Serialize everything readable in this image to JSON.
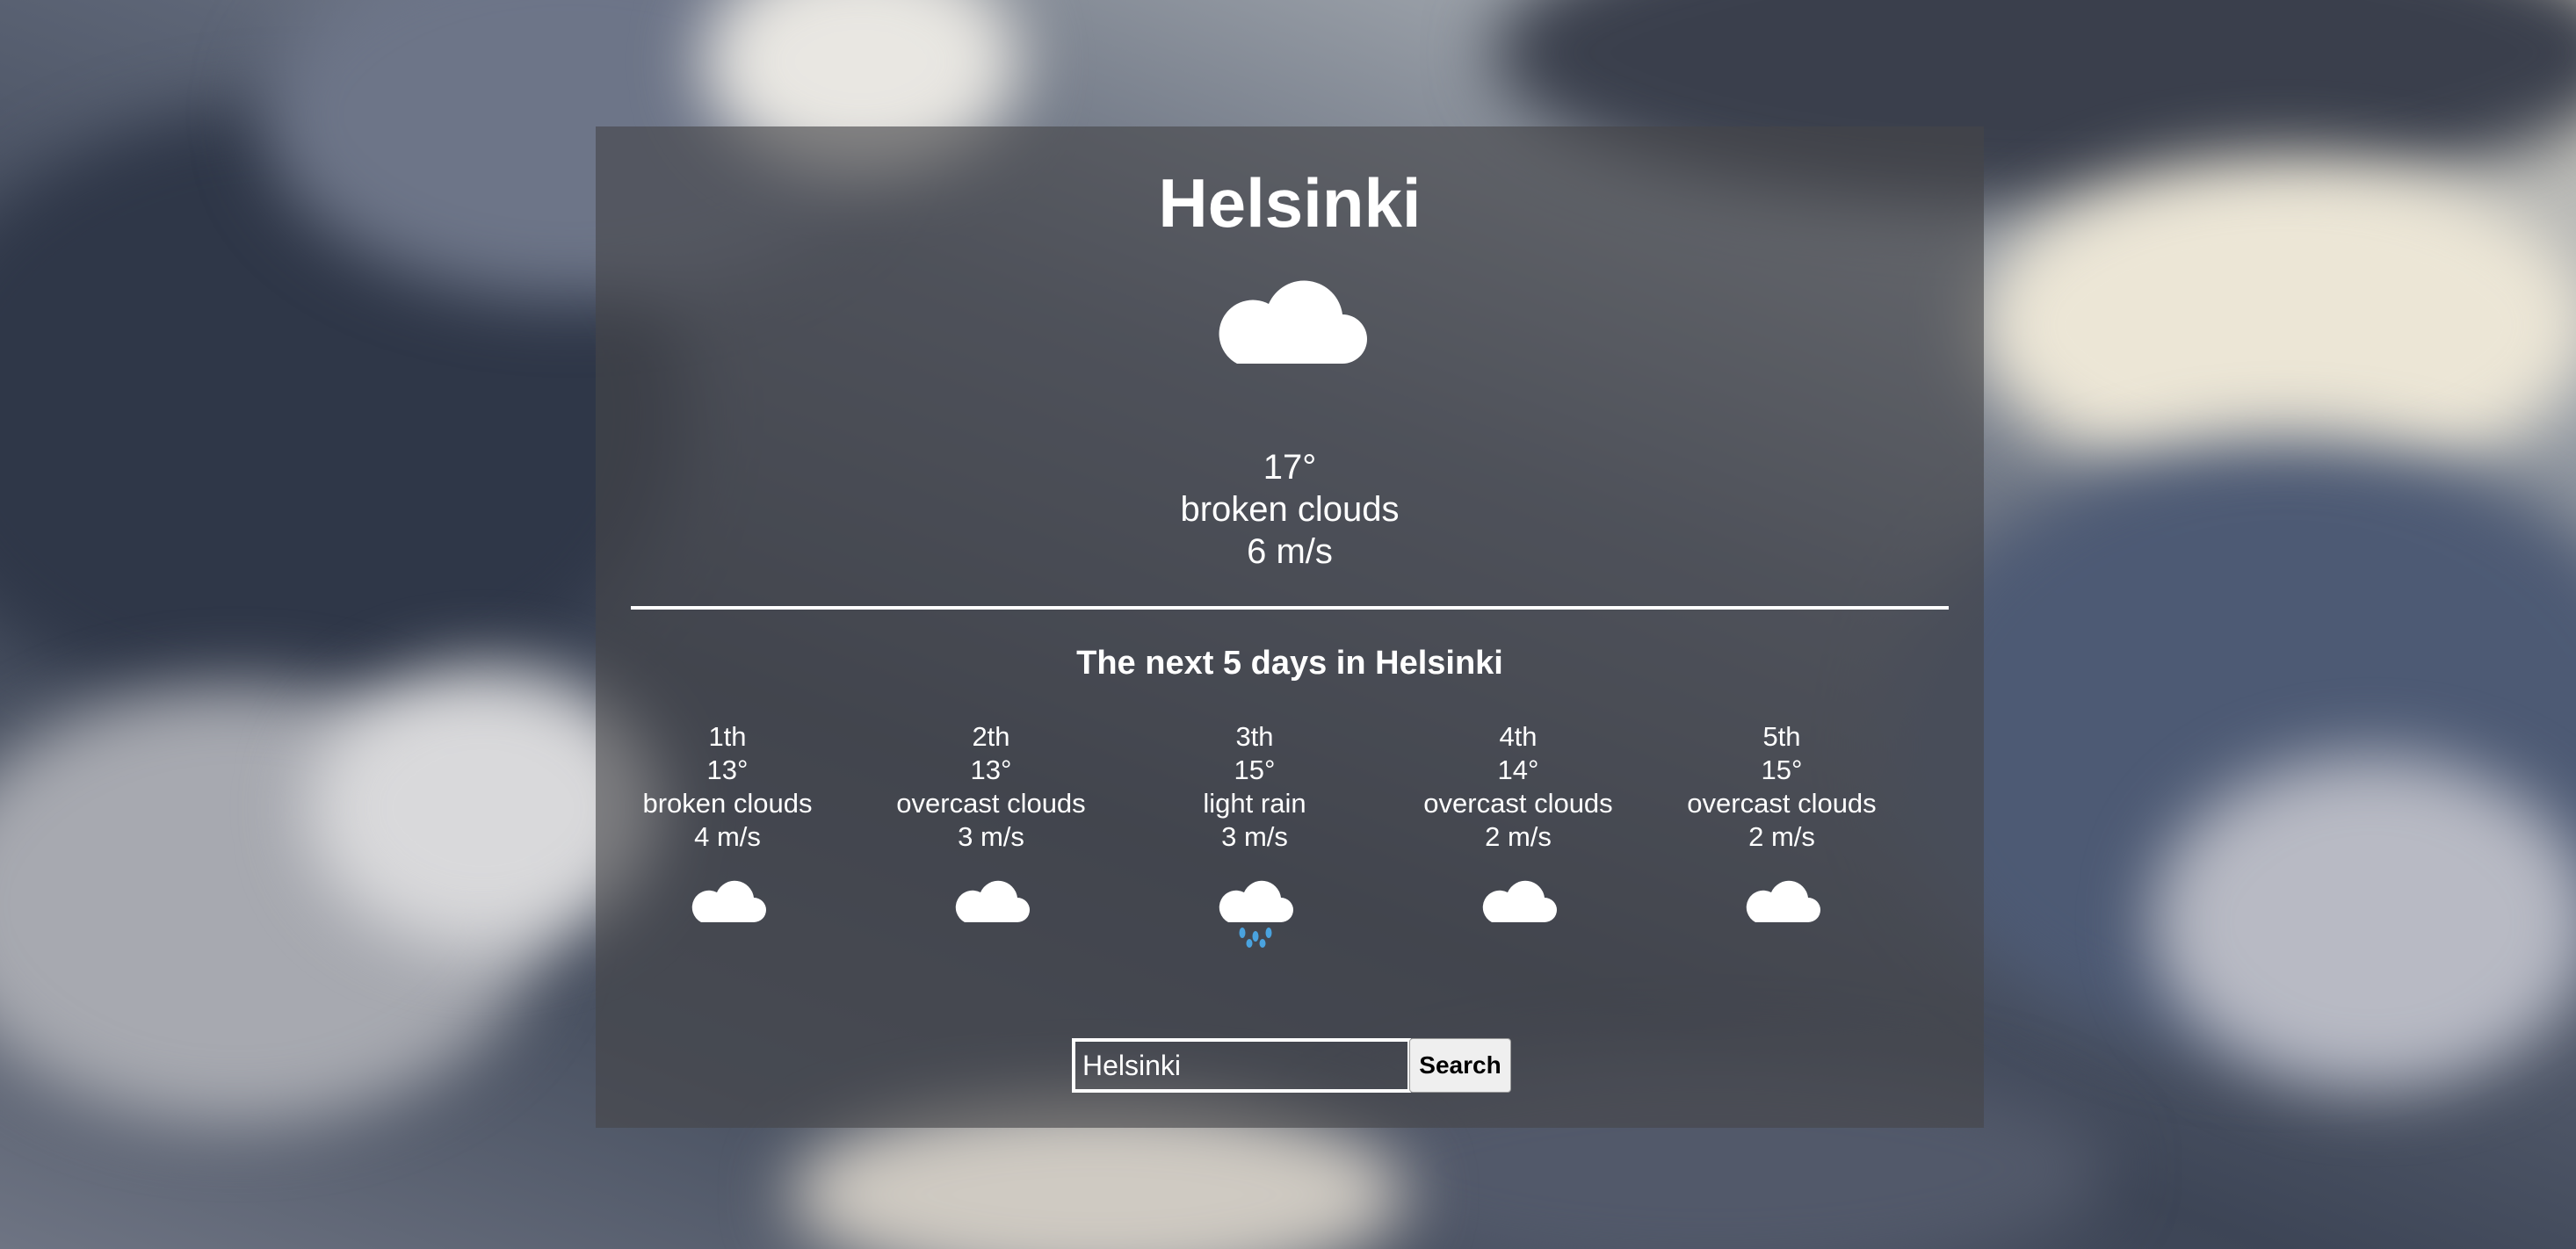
{
  "current": {
    "city": "Helsinki",
    "temperature": "17°",
    "description": "broken clouds",
    "wind": "6 m/s",
    "icon": "cloud-icon"
  },
  "forecast": {
    "title": "The next 5 days in Helsinki",
    "days": [
      {
        "day": "1th",
        "temp": "13°",
        "description": "broken clouds",
        "wind": "4 m/s",
        "icon": "cloud-icon"
      },
      {
        "day": "2th",
        "temp": "13°",
        "description": "overcast clouds",
        "wind": "3 m/s",
        "icon": "cloud-icon"
      },
      {
        "day": "3th",
        "temp": "15°",
        "description": "light rain",
        "wind": "3 m/s",
        "icon": "rain-cloud-icon"
      },
      {
        "day": "4th",
        "temp": "14°",
        "description": "overcast clouds",
        "wind": "2 m/s",
        "icon": "cloud-icon"
      },
      {
        "day": "5th",
        "temp": "15°",
        "description": "overcast clouds",
        "wind": "2 m/s",
        "icon": "cloud-icon"
      }
    ]
  },
  "search": {
    "value": "Helsinki",
    "button_label": "Search"
  },
  "colors": {
    "text": "#ffffff",
    "rain_drops": "#4aa3df",
    "button_bg": "#efefef"
  }
}
